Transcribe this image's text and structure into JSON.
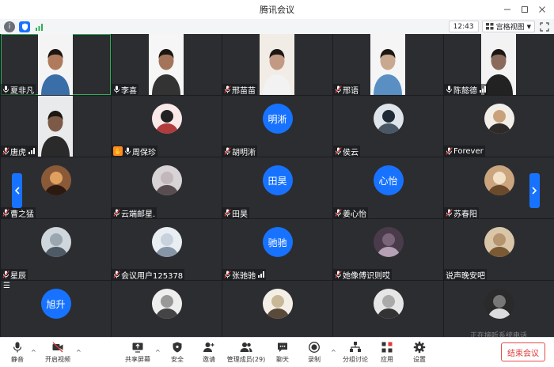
{
  "window": {
    "title": "腾讯会议"
  },
  "topbar": {
    "time": "12:43",
    "view_label": "宫格视图"
  },
  "tiles": [
    {
      "name": "夏非凡",
      "mic": "on",
      "type": "video",
      "active": true
    },
    {
      "name": "李喜",
      "mic": "on",
      "type": "video"
    },
    {
      "name": "邢苗苗",
      "mic": "muted",
      "type": "video"
    },
    {
      "name": "邢语",
      "mic": "muted",
      "type": "video"
    },
    {
      "name": "陈懿德",
      "mic": "on",
      "type": "video",
      "signal": true
    },
    {
      "name": "唐虎",
      "mic": "muted",
      "type": "video",
      "signal": true
    },
    {
      "name": "周保珍",
      "mic": "on",
      "type": "avatar",
      "hand": true
    },
    {
      "name": "胡明淅",
      "mic": "muted",
      "type": "bubble",
      "bubble_text": "明淅"
    },
    {
      "name": "侯云",
      "mic": "muted",
      "type": "avatar"
    },
    {
      "name": "Forever",
      "mic": "muted",
      "type": "avatar"
    },
    {
      "name": "曹之猛",
      "mic": "muted",
      "type": "avatar"
    },
    {
      "name": "云端邮星.",
      "mic": "muted",
      "type": "avatar"
    },
    {
      "name": "田昊",
      "mic": "muted",
      "type": "bubble",
      "bubble_text": "田昊"
    },
    {
      "name": "姜心怡",
      "mic": "muted",
      "type": "bubble",
      "bubble_text": "心怡"
    },
    {
      "name": "苏春阳",
      "mic": "muted",
      "type": "avatar"
    },
    {
      "name": "星辰",
      "mic": "muted",
      "type": "avatar"
    },
    {
      "name": "会议用户125378",
      "mic": "muted",
      "type": "avatar"
    },
    {
      "name": "张驰驰",
      "mic": "muted",
      "type": "bubble",
      "bubble_text": "驰驰",
      "signal": true
    },
    {
      "name": "她像傅识则哎",
      "mic": "muted",
      "type": "avatar"
    },
    {
      "name": "说声晚安吧",
      "mic": "none",
      "type": "avatar"
    },
    {
      "name": "",
      "mic": "none",
      "type": "bubble",
      "bubble_text": "旭升"
    },
    {
      "name": "",
      "mic": "none",
      "type": "avatar"
    },
    {
      "name": "",
      "mic": "none",
      "type": "avatar"
    },
    {
      "name": "",
      "mic": "none",
      "type": "avatar"
    },
    {
      "name": "",
      "mic": "none",
      "type": "avatar"
    }
  ],
  "overlay_text": "正在接听系统电话",
  "toolbar": {
    "mute": "静音",
    "video": "开启视频",
    "share": "共享屏幕",
    "security": "安全",
    "invite": "邀请",
    "members": "管理成员(29)",
    "chat": "聊天",
    "record": "录制",
    "breakout": "分组讨论",
    "apps": "应用",
    "settings": "设置",
    "end": "结束会议"
  },
  "colors": {
    "accent": "#1773ff",
    "end": "#e03a3a",
    "tile_bg": "#2c2d31"
  }
}
